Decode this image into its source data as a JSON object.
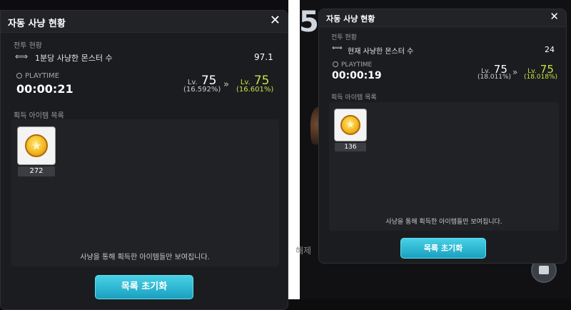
{
  "left_panel": {
    "title": "자동 사냥 현황",
    "battle_label": "전투 현황",
    "stat_label": "1분당 사냥한 몬스터 수",
    "stat_value": "97.1",
    "playtime_label": "PLAYTIME",
    "playtime": "00:00:21",
    "lv_word": "Lv.",
    "lv_from": "75",
    "lv_from_pct": "(16.592%)",
    "lv_to": "75",
    "lv_to_pct": "(16.601%)",
    "items_label": "획득 아이템 목록",
    "item_count": "272",
    "hint": "사냥을 통해 획득한 아이템들만 보여집니다.",
    "reset_button": "목록 초기화"
  },
  "right_panel": {
    "title": "자동 사냥 현황",
    "battle_label": "전투 현황",
    "stat_label": "현재 사냥한 몬스터 수",
    "stat_value": "24",
    "playtime_label": "PLAYTIME",
    "playtime": "00:00:19",
    "lv_word": "Lv.",
    "lv_from": "75",
    "lv_from_pct": "(18.011%)",
    "lv_to": "75",
    "lv_to_pct": "(18.018%)",
    "items_label": "획득 아이템 목록",
    "item_count": "136",
    "hint": "사냥을 통해 획득한 아이템들만 보여집니다.",
    "reset_button": "목록 초기화"
  },
  "background": {
    "glyph": "5",
    "text_fragment": "해제"
  },
  "colors": {
    "accent_level": "#c8e04a",
    "button": "#1aa0c0"
  },
  "icons": [
    "close-icon",
    "swap-arrows-icon",
    "clock-icon",
    "double-chevron-icon",
    "gold-coin-icon",
    "bag-icon"
  ]
}
